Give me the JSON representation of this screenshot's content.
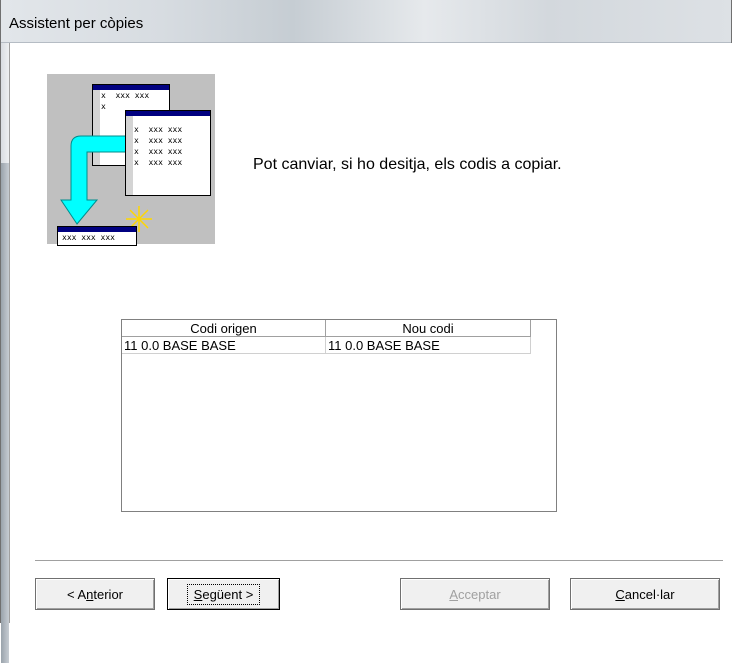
{
  "window": {
    "title": "Assistent per còpies"
  },
  "illustration": {
    "top_sheet_rows": [
      "x  xxx xxx",
      "x"
    ],
    "front_sheet_rows": [
      "x  xxx xxx",
      "x  xxx xxx",
      "x  xxx xxx",
      "x  xxx xxx"
    ],
    "target_row": "xxx xxx xxx",
    "arrow_color": "#00ffff",
    "header_color": "#000080"
  },
  "prompt": "Pot canviar, si ho desitja, els codis a copiar.",
  "table": {
    "columns": [
      "Codi origen",
      "Nou codi"
    ],
    "rows": [
      [
        "11 0.0 BASE BASE",
        "11 0.0 BASE BASE"
      ]
    ]
  },
  "buttons": {
    "back": {
      "pre": "< A",
      "key": "n",
      "post": "terior"
    },
    "next": {
      "pre": "",
      "key": "S",
      "post": "egüent >"
    },
    "accept": {
      "pre": "",
      "key": "A",
      "post": "cceptar"
    },
    "cancel": {
      "pre": "",
      "key": "C",
      "post": "ancel·lar"
    }
  }
}
